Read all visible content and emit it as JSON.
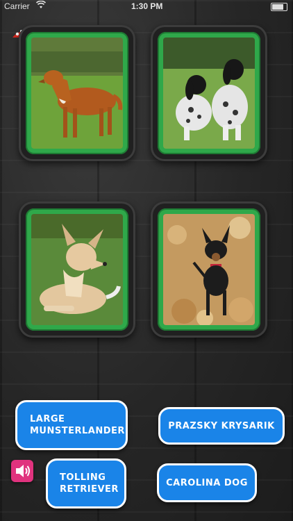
{
  "status_bar": {
    "carrier": "Carrier",
    "time": "1:30 PM"
  },
  "icons": {
    "hint": "mushroom-icon",
    "sound": "speaker-icon"
  },
  "cards": [
    {
      "image": "tolling retriever dog standing on grass"
    },
    {
      "image": "two munsterlander dogs sitting on grass"
    },
    {
      "image": "carolina dog lying on grass"
    },
    {
      "image": "prazsky krysarik dog standing on leaves"
    }
  ],
  "answers": {
    "large_munsterlander": {
      "line1": "LARGE",
      "line2": "MUNSTERLANDER"
    },
    "prazsky_krysarik": {
      "line1": "PRAZSKY KRYSARIK"
    },
    "tolling_retriever": {
      "line1": "TOLLING",
      "line2": "RETRIEVER"
    },
    "carolina_dog": {
      "line1": "CAROLINA DOG"
    }
  },
  "colors": {
    "frame_green": "#2fa84a",
    "button_blue": "#1a84e8",
    "sound_pink": "#e0337e"
  }
}
